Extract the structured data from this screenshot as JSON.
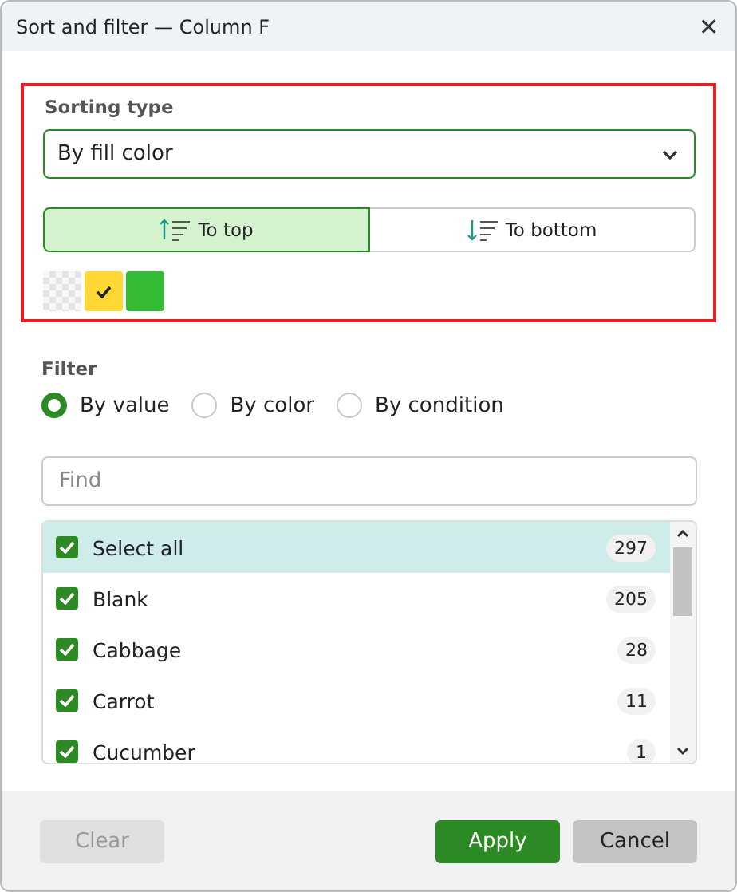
{
  "window": {
    "title": "Sort and filter — Column F",
    "close_glyph": "✕"
  },
  "sorting": {
    "label": "Sorting type",
    "type_value": "By fill color",
    "directions": [
      {
        "label": "To top",
        "kind": "up",
        "selected": true
      },
      {
        "label": "To bottom",
        "kind": "down",
        "selected": false
      }
    ],
    "swatches": [
      {
        "kind": "none",
        "selected": false
      },
      {
        "kind": "color",
        "color": "#ffd836",
        "selected": true
      },
      {
        "kind": "color",
        "color": "#35bb35",
        "selected": false
      }
    ]
  },
  "filter": {
    "label": "Filter",
    "modes": [
      {
        "label": "By value",
        "selected": true
      },
      {
        "label": "By color",
        "selected": false
      },
      {
        "label": "By condition",
        "selected": false
      }
    ],
    "search": {
      "placeholder": "Find"
    },
    "items": [
      {
        "label": "Select all",
        "count": "297",
        "checked": true,
        "selected": true
      },
      {
        "label": "Blank",
        "count": "205",
        "checked": true,
        "selected": false
      },
      {
        "label": "Cabbage",
        "count": "28",
        "checked": true,
        "selected": false
      },
      {
        "label": "Carrot",
        "count": "11",
        "checked": true,
        "selected": false
      },
      {
        "label": "Cucumber",
        "count": "1",
        "checked": true,
        "selected": false
      }
    ]
  },
  "buttons": [
    {
      "label": "Clear",
      "kind": "secondary",
      "disabled": true
    },
    {
      "label": "Apply",
      "kind": "primary",
      "disabled": false
    },
    {
      "label": "Cancel",
      "kind": "secondary",
      "disabled": false
    }
  ]
}
